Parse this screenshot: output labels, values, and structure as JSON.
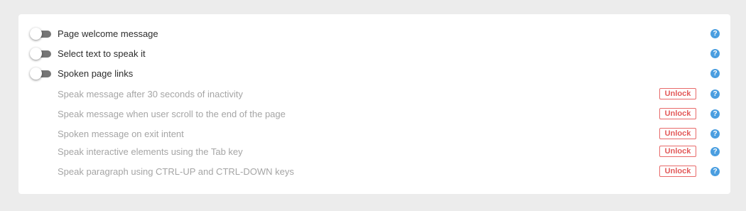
{
  "colors": {
    "page_background": "#ececec",
    "card_background": "#ffffff",
    "toggle_track": "#757575",
    "main_text": "#2d2d2d",
    "locked_text": "#a5a5a5",
    "unlock_accent": "#e25a5a",
    "help_icon": "#4a9ee0"
  },
  "help_symbol": "?",
  "toggle_settings": [
    {
      "label": "Page welcome message",
      "enabled": false,
      "icon": "question-circle-icon"
    },
    {
      "label": "Select text to speak it",
      "enabled": false,
      "icon": "question-circle-icon"
    },
    {
      "label": "Spoken page links",
      "enabled": false,
      "icon": "question-circle-icon"
    }
  ],
  "locked_settings": [
    {
      "label": "Speak message after 30 seconds of inactivity",
      "action": "Unlock",
      "icon": "question-circle-icon"
    },
    {
      "label": "Speak message when user scroll to the end of the page",
      "action": "Unlock",
      "icon": "question-circle-icon"
    },
    {
      "label": "Spoken message on exit intent",
      "action": "Unlock",
      "icon": "question-circle-icon"
    },
    {
      "label": "Speak interactive elements using the Tab key",
      "action": "Unlock",
      "icon": "question-circle-icon"
    },
    {
      "label": "Speak paragraph using CTRL-UP and CTRL-DOWN keys",
      "action": "Unlock",
      "icon": "question-circle-icon"
    }
  ]
}
